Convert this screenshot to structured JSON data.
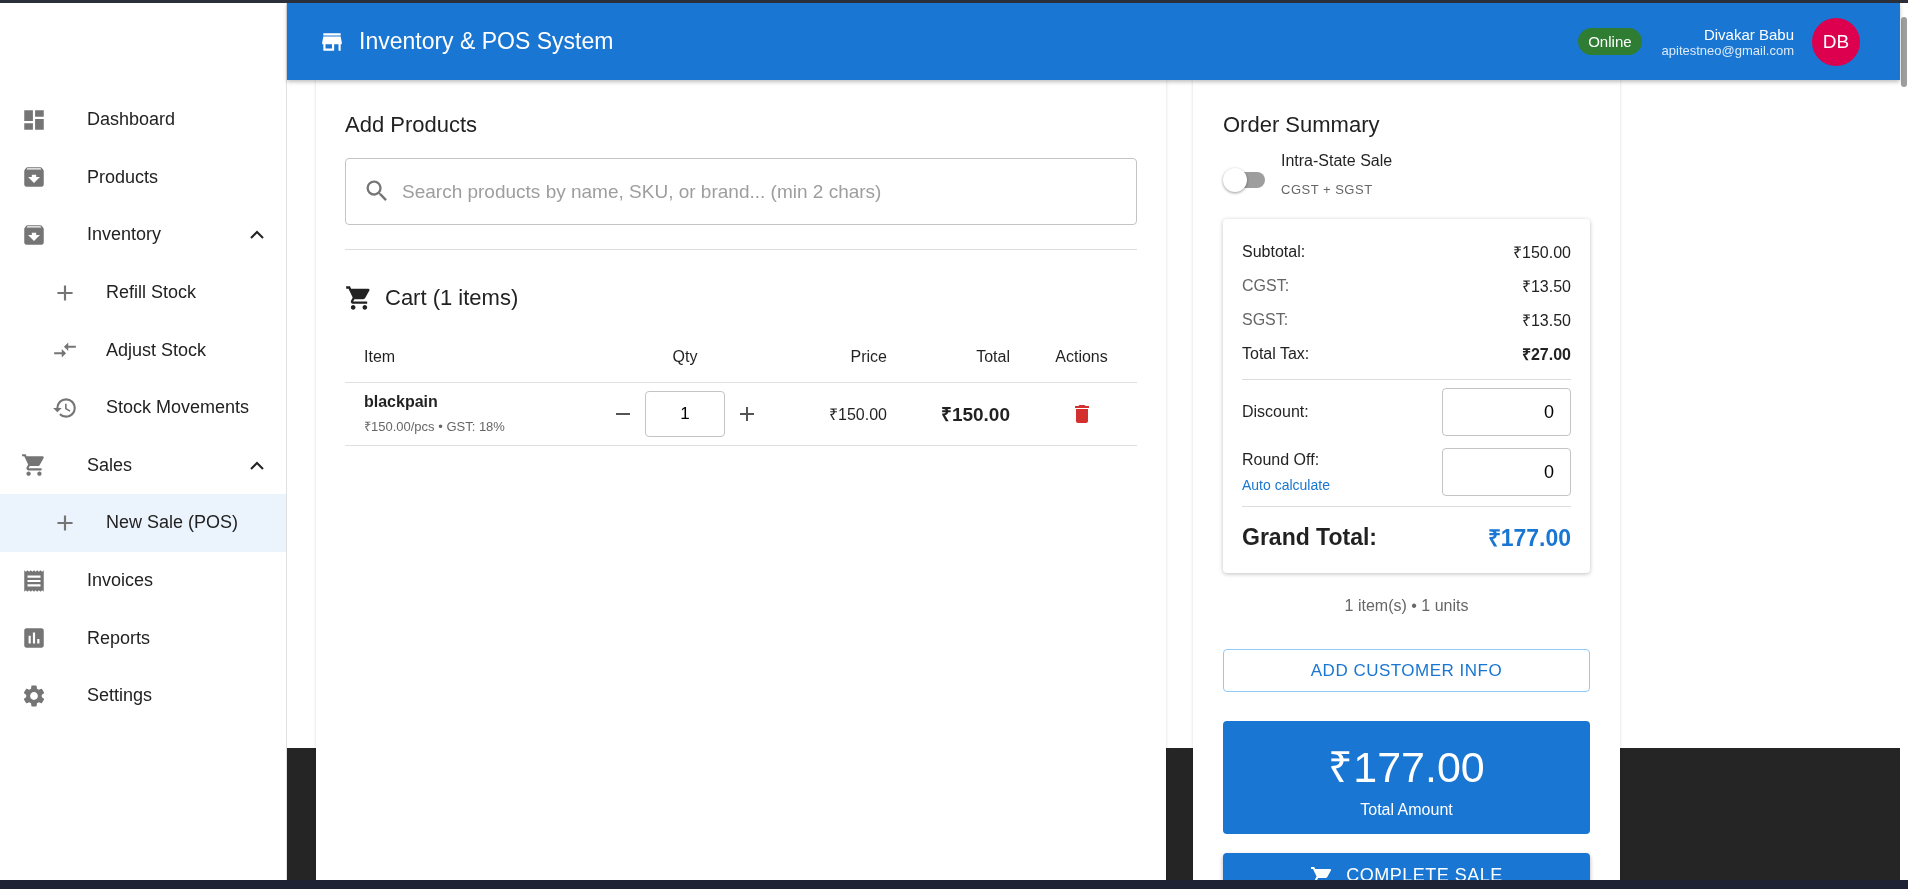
{
  "header": {
    "title": "Inventory & POS System",
    "status": "Online",
    "user_name": "Divakar Babu",
    "user_email": "apitestneo@gmail.com",
    "avatar": "DB"
  },
  "sidebar": {
    "items": [
      {
        "label": "Dashboard",
        "selected": false
      },
      {
        "label": "Products",
        "selected": false
      },
      {
        "label": "Inventory",
        "selected": false,
        "expanded": true,
        "children": [
          {
            "label": "Refill Stock",
            "selected": false
          },
          {
            "label": "Adjust Stock",
            "selected": false
          },
          {
            "label": "Stock Movements",
            "selected": false
          }
        ]
      },
      {
        "label": "Sales",
        "selected": false,
        "expanded": true,
        "children": [
          {
            "label": "New Sale (POS)",
            "selected": true
          }
        ]
      },
      {
        "label": "Invoices",
        "selected": false
      },
      {
        "label": "Reports",
        "selected": false
      },
      {
        "label": "Settings",
        "selected": false
      }
    ]
  },
  "add_products": {
    "title": "Add Products",
    "search": {
      "placeholder": "Search products by name, SKU, or brand... (min 2 chars)"
    }
  },
  "cart": {
    "title": "Cart (1 items)",
    "columns": [
      "Item",
      "Qty",
      "Price",
      "Total",
      "Actions"
    ],
    "rows": [
      {
        "name": "blackpain",
        "meta": "₹150.00/pcs • GST: 18%",
        "qty": "1",
        "price": "₹150.00",
        "total": "₹150.00"
      }
    ]
  },
  "summary": {
    "title": "Order Summary",
    "toggle": {
      "label": "Intra-State Sale",
      "sub": "CGST + SGST",
      "on": false
    },
    "lines": [
      {
        "label": "Subtotal:",
        "value": "₹150.00",
        "kind": "normal"
      },
      {
        "label": "CGST:",
        "value": "₹13.50",
        "kind": "muted"
      },
      {
        "label": "SGST:",
        "value": "₹13.50",
        "kind": "muted"
      },
      {
        "label": "Total Tax:",
        "value": "₹27.00",
        "kind": "strong"
      }
    ],
    "discount": {
      "label": "Discount:",
      "value": "0"
    },
    "round_off": {
      "label": "Round Off:",
      "link": "Auto calculate",
      "value": "0"
    },
    "grand_total": {
      "label": "Grand Total:",
      "value": "₹177.00"
    },
    "counts": "1 item(s) • 1 units",
    "customer_button": "ADD CUSTOMER INFO",
    "total_box": {
      "amount": "₹177.00",
      "label": "Total Amount"
    },
    "complete_button": "COMPLETE SALE"
  }
}
